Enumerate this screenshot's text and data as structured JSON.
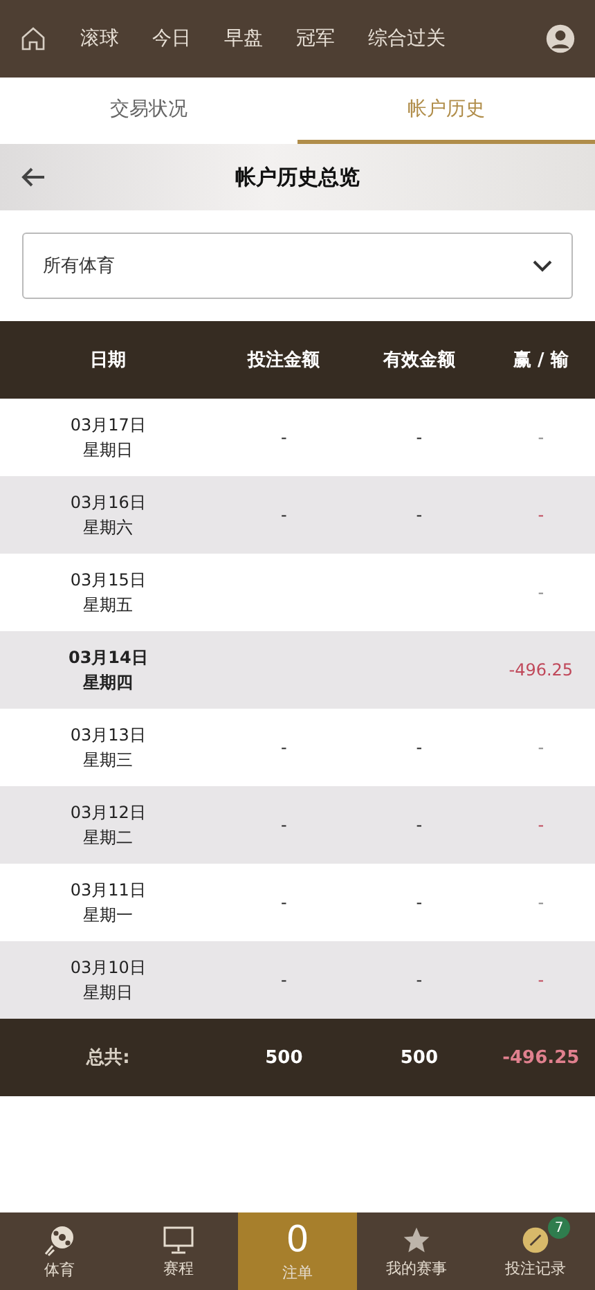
{
  "top_nav": {
    "items": [
      "滚球",
      "今日",
      "早盘",
      "冠军",
      "综合过关"
    ]
  },
  "tabs": [
    {
      "label": "交易状况",
      "selected": false
    },
    {
      "label": "帐户历史",
      "selected": true
    }
  ],
  "header": {
    "title": "帐户历史总览"
  },
  "filter": {
    "value": "所有体育"
  },
  "table": {
    "columns": [
      "日期",
      "投注金额",
      "有效金额",
      "赢 / 输"
    ],
    "rows": [
      {
        "date": "03月17日",
        "weekday": "星期日",
        "stake": "-",
        "valid": "-",
        "result": "-",
        "negative": false,
        "bold": false
      },
      {
        "date": "03月16日",
        "weekday": "星期六",
        "stake": "-",
        "valid": "-",
        "result": "-",
        "negative": true,
        "bold": false
      },
      {
        "date": "03月15日",
        "weekday": "星期五",
        "result": "-",
        "negative": false,
        "bold": false
      },
      {
        "date": "03月14日",
        "weekday": "星期四",
        "result": "-496.25",
        "negative": true,
        "bold": true
      },
      {
        "date": "03月13日",
        "weekday": "星期三",
        "stake": "-",
        "valid": "-",
        "result": "-",
        "negative": false,
        "bold": false
      },
      {
        "date": "03月12日",
        "weekday": "星期二",
        "stake": "-",
        "valid": "-",
        "result": "-",
        "negative": true,
        "bold": false
      },
      {
        "date": "03月11日",
        "weekday": "星期一",
        "stake": "-",
        "valid": "-",
        "result": "-",
        "negative": false,
        "bold": false
      },
      {
        "date": "03月10日",
        "weekday": "星期日",
        "stake": "-",
        "valid": "-",
        "result": "-",
        "negative": true,
        "bold": false
      }
    ],
    "total": {
      "label": "总共:",
      "stake": "500",
      "valid": "500",
      "result": "-496.25"
    }
  },
  "bottom_nav": [
    {
      "kind": "sports",
      "label": "体育",
      "selected": false
    },
    {
      "kind": "schedule",
      "label": "赛程",
      "selected": false
    },
    {
      "kind": "betslip",
      "count": "0",
      "label": "注单",
      "selected": true
    },
    {
      "kind": "my",
      "label": "我的赛事",
      "selected": false
    },
    {
      "kind": "records",
      "label": "投注记录",
      "badge": "7",
      "selected": false
    }
  ]
}
